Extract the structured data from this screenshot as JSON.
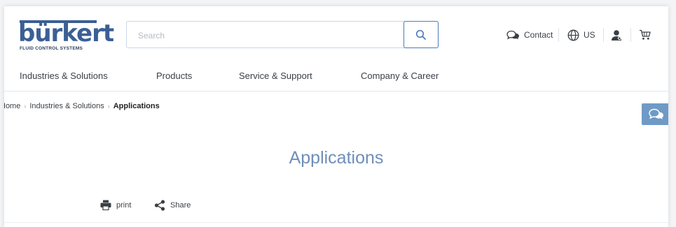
{
  "brand": {
    "logo_word": "bürkert",
    "tagline": "FLUID CONTROL SYSTEMS"
  },
  "search": {
    "placeholder": "Search"
  },
  "utility": {
    "contact_label": "Contact",
    "region_label": "US"
  },
  "nav": [
    "Industries & Solutions",
    "Products",
    "Service & Support",
    "Company & Career"
  ],
  "breadcrumb": [
    "Home",
    "Industries & Solutions",
    "Applications"
  ],
  "page": {
    "title": "Applications"
  },
  "actions": {
    "print_label": "print",
    "share_label": "Share"
  },
  "icons": {
    "search": "search-icon",
    "contact": "chat-icon",
    "region": "globe-icon",
    "account": "user-icon",
    "cart": "cart-icon",
    "print": "printer-icon",
    "share": "share-icon",
    "chat_float": "chat-icon"
  },
  "colors": {
    "brand": "#3b5f95",
    "title": "#6f8fb8",
    "chat_tab": "#6f9ac6",
    "search_button_border": "#4d7bb8"
  }
}
